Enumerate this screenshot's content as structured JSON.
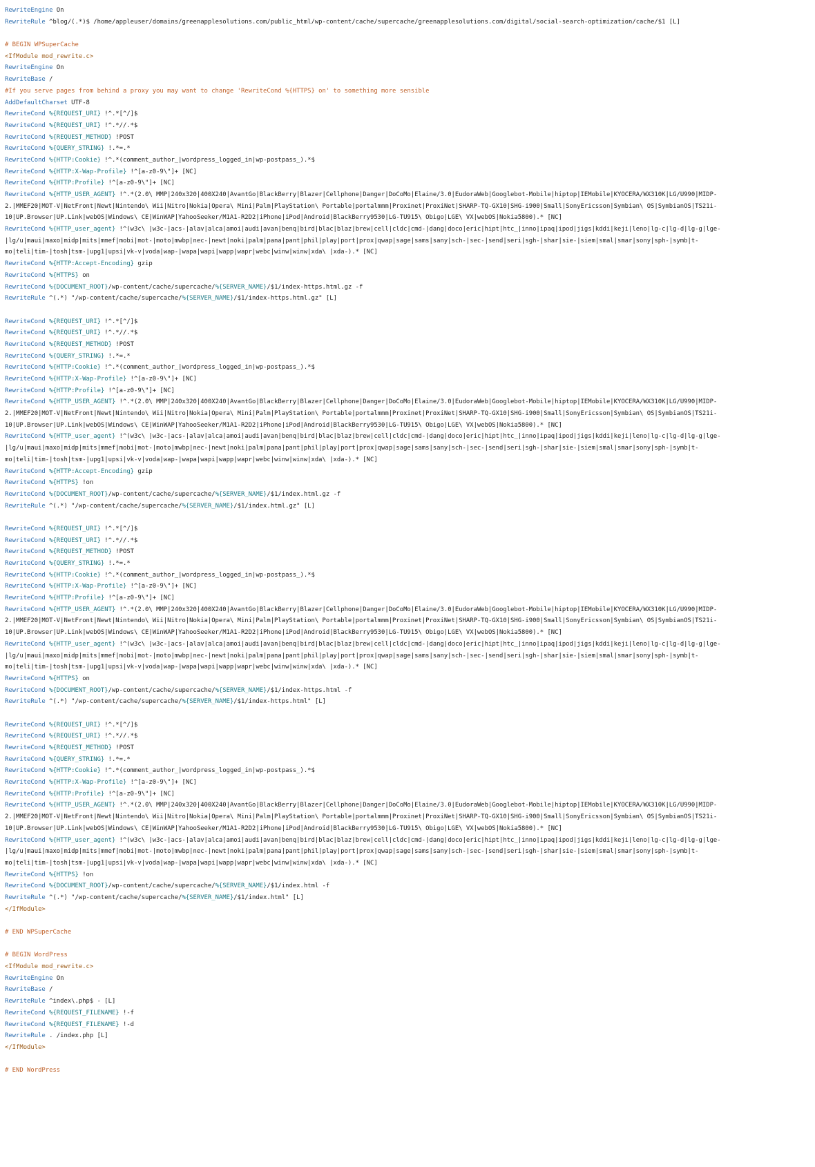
{
  "colors": {
    "directive": "#2f6fb0",
    "comment": "#c0622b",
    "tag": "#9b5a17",
    "variable": "#207b87",
    "text": "#222222",
    "background": "#ffffff"
  },
  "lines": [
    "RewriteEngine On",
    "RewriteRule ^blog/(.*)$ /home/appleuser/domains/greenapplesolutions.com/public_html/wp-content/cache/supercache/greenapplesolutions.com/digital/social-search-optimization/cache/$1 [L]",
    "",
    "# BEGIN WPSuperCache",
    "<IfModule mod_rewrite.c>",
    "RewriteEngine On",
    "RewriteBase /",
    "#If you serve pages from behind a proxy you may want to change 'RewriteCond %{HTTPS} on' to something more sensible",
    "AddDefaultCharset UTF-8",
    "RewriteCond %{REQUEST_URI} !^.*[^/]$",
    "RewriteCond %{REQUEST_URI} !^.*//.*$",
    "RewriteCond %{REQUEST_METHOD} !POST",
    "RewriteCond %{QUERY_STRING} !.*=.*",
    "RewriteCond %{HTTP:Cookie} !^.*(comment_author_|wordpress_logged_in|wp-postpass_).*$",
    "RewriteCond %{HTTP:X-Wap-Profile} !^[a-z0-9\\\"]+ [NC]",
    "RewriteCond %{HTTP:Profile} !^[a-z0-9\\\"]+ [NC]",
    "RewriteCond %{HTTP_USER_AGENT} !^.*(2.0\\ MMP|240x320|400X240|AvantGo|BlackBerry|Blazer|Cellphone|Danger|DoCoMo|Elaine/3.0|EudoraWeb|Googlebot-Mobile|hiptop|IEMobile|KYOCERA/WX310K|LG/U990|MIDP-",
    "2.|MMEF20|MOT-V|NetFront|Newt|Nintendo\\ Wii|Nitro|Nokia|Opera\\ Mini|Palm|PlayStation\\ Portable|portalmmm|Proxinet|ProxiNet|SHARP-TQ-GX10|SHG-i900|Small|SonyEricsson|Symbian\\ OS|SymbianOS|TS21i-",
    "10|UP.Browser|UP.Link|webOS|Windows\\ CE|WinWAP|YahooSeeker/M1A1-R2D2|iPhone|iPod|Android|BlackBerry9530|LG-TU915\\ Obigo|LGE\\ VX|webOS|Nokia5800).* [NC]",
    "RewriteCond %{HTTP_user_agent} !^(w3c\\ |w3c-|acs-|alav|alca|amoi|audi|avan|benq|bird|blac|blaz|brew|cell|cldc|cmd-|dang|doco|eric|hipt|htc_|inno|ipaq|ipod|jigs|kddi|keji|leno|lg-c|lg-d|lg-g|lge-",
    "|lg/u|maui|maxo|midp|mits|mmef|mobi|mot-|moto|mwbp|nec-|newt|noki|palm|pana|pant|phil|play|port|prox|qwap|sage|sams|sany|sch-|sec-|send|seri|sgh-|shar|sie-|siem|smal|smar|sony|sph-|symb|t-",
    "mo|teli|tim-|tosh|tsm-|upg1|upsi|vk-v|voda|wap-|wapa|wapi|wapp|wapr|webc|winw|winw|xda\\ |xda-).* [NC]",
    "RewriteCond %{HTTP:Accept-Encoding} gzip",
    "RewriteCond %{HTTPS} on",
    "RewriteCond %{DOCUMENT_ROOT}/wp-content/cache/supercache/%{SERVER_NAME}/$1/index-https.html.gz -f",
    "RewriteRule ^(.*) \"/wp-content/cache/supercache/%{SERVER_NAME}/$1/index-https.html.gz\" [L]",
    "",
    "RewriteCond %{REQUEST_URI} !^.*[^/]$",
    "RewriteCond %{REQUEST_URI} !^.*//.*$",
    "RewriteCond %{REQUEST_METHOD} !POST",
    "RewriteCond %{QUERY_STRING} !.*=.*",
    "RewriteCond %{HTTP:Cookie} !^.*(comment_author_|wordpress_logged_in|wp-postpass_).*$",
    "RewriteCond %{HTTP:X-Wap-Profile} !^[a-z0-9\\\"]+ [NC]",
    "RewriteCond %{HTTP:Profile} !^[a-z0-9\\\"]+ [NC]",
    "RewriteCond %{HTTP_USER_AGENT} !^.*(2.0\\ MMP|240x320|400X240|AvantGo|BlackBerry|Blazer|Cellphone|Danger|DoCoMo|Elaine/3.0|EudoraWeb|Googlebot-Mobile|hiptop|IEMobile|KYOCERA/WX310K|LG/U990|MIDP-",
    "2.|MMEF20|MOT-V|NetFront|Newt|Nintendo\\ Wii|Nitro|Nokia|Opera\\ Mini|Palm|PlayStation\\ Portable|portalmmm|Proxinet|ProxiNet|SHARP-TQ-GX10|SHG-i900|Small|SonyEricsson|Symbian\\ OS|SymbianOS|TS21i-",
    "10|UP.Browser|UP.Link|webOS|Windows\\ CE|WinWAP|YahooSeeker/M1A1-R2D2|iPhone|iPod|Android|BlackBerry9530|LG-TU915\\ Obigo|LGE\\ VX|webOS|Nokia5800).* [NC]",
    "RewriteCond %{HTTP_user_agent} !^(w3c\\ |w3c-|acs-|alav|alca|amoi|audi|avan|benq|bird|blac|blaz|brew|cell|cldc|cmd-|dang|doco|eric|hipt|htc_|inno|ipaq|ipod|jigs|kddi|keji|leno|lg-c|lg-d|lg-g|lge-",
    "|lg/u|maui|maxo|midp|mits|mmef|mobi|mot-|moto|mwbp|nec-|newt|noki|palm|pana|pant|phil|play|port|prox|qwap|sage|sams|sany|sch-|sec-|send|seri|sgh-|shar|sie-|siem|smal|smar|sony|sph-|symb|t-",
    "mo|teli|tim-|tosh|tsm-|upg1|upsi|vk-v|voda|wap-|wapa|wapi|wapp|wapr|webc|winw|winw|xda\\ |xda-).* [NC]",
    "RewriteCond %{HTTP:Accept-Encoding} gzip",
    "RewriteCond %{HTTPS} !on",
    "RewriteCond %{DOCUMENT_ROOT}/wp-content/cache/supercache/%{SERVER_NAME}/$1/index.html.gz -f",
    "RewriteRule ^(.*) \"/wp-content/cache/supercache/%{SERVER_NAME}/$1/index.html.gz\" [L]",
    "",
    "RewriteCond %{REQUEST_URI} !^.*[^/]$",
    "RewriteCond %{REQUEST_URI} !^.*//.*$",
    "RewriteCond %{REQUEST_METHOD} !POST",
    "RewriteCond %{QUERY_STRING} !.*=.*",
    "RewriteCond %{HTTP:Cookie} !^.*(comment_author_|wordpress_logged_in|wp-postpass_).*$",
    "RewriteCond %{HTTP:X-Wap-Profile} !^[a-z0-9\\\"]+ [NC]",
    "RewriteCond %{HTTP:Profile} !^[a-z0-9\\\"]+ [NC]",
    "RewriteCond %{HTTP_USER_AGENT} !^.*(2.0\\ MMP|240x320|400X240|AvantGo|BlackBerry|Blazer|Cellphone|Danger|DoCoMo|Elaine/3.0|EudoraWeb|Googlebot-Mobile|hiptop|IEMobile|KYOCERA/WX310K|LG/U990|MIDP-",
    "2.|MMEF20|MOT-V|NetFront|Newt|Nintendo\\ Wii|Nitro|Nokia|Opera\\ Mini|Palm|PlayStation\\ Portable|portalmmm|Proxinet|ProxiNet|SHARP-TQ-GX10|SHG-i900|Small|SonyEricsson|Symbian\\ OS|SymbianOS|TS21i-",
    "10|UP.Browser|UP.Link|webOS|Windows\\ CE|WinWAP|YahooSeeker/M1A1-R2D2|iPhone|iPod|Android|BlackBerry9530|LG-TU915\\ Obigo|LGE\\ VX|webOS|Nokia5800).* [NC]",
    "RewriteCond %{HTTP_user_agent} !^(w3c\\ |w3c-|acs-|alav|alca|amoi|audi|avan|benq|bird|blac|blaz|brew|cell|cldc|cmd-|dang|doco|eric|hipt|htc_|inno|ipaq|ipod|jigs|kddi|keji|leno|lg-c|lg-d|lg-g|lge-",
    "|lg/u|maui|maxo|midp|mits|mmef|mobi|mot-|moto|mwbp|nec-|newt|noki|palm|pana|pant|phil|play|port|prox|qwap|sage|sams|sany|sch-|sec-|send|seri|sgh-|shar|sie-|siem|smal|smar|sony|sph-|symb|t-",
    "mo|teli|tim-|tosh|tsm-|upg1|upsi|vk-v|voda|wap-|wapa|wapi|wapp|wapr|webc|winw|winw|xda\\ |xda-).* [NC]",
    "RewriteCond %{HTTPS} on",
    "RewriteCond %{DOCUMENT_ROOT}/wp-content/cache/supercache/%{SERVER_NAME}/$1/index-https.html -f",
    "RewriteRule ^(.*) \"/wp-content/cache/supercache/%{SERVER_NAME}/$1/index-https.html\" [L]",
    "",
    "RewriteCond %{REQUEST_URI} !^.*[^/]$",
    "RewriteCond %{REQUEST_URI} !^.*//.*$",
    "RewriteCond %{REQUEST_METHOD} !POST",
    "RewriteCond %{QUERY_STRING} !.*=.*",
    "RewriteCond %{HTTP:Cookie} !^.*(comment_author_|wordpress_logged_in|wp-postpass_).*$",
    "RewriteCond %{HTTP:X-Wap-Profile} !^[a-z0-9\\\"]+ [NC]",
    "RewriteCond %{HTTP:Profile} !^[a-z0-9\\\"]+ [NC]",
    "RewriteCond %{HTTP_USER_AGENT} !^.*(2.0\\ MMP|240x320|400X240|AvantGo|BlackBerry|Blazer|Cellphone|Danger|DoCoMo|Elaine/3.0|EudoraWeb|Googlebot-Mobile|hiptop|IEMobile|KYOCERA/WX310K|LG/U990|MIDP-",
    "2.|MMEF20|MOT-V|NetFront|Newt|Nintendo\\ Wii|Nitro|Nokia|Opera\\ Mini|Palm|PlayStation\\ Portable|portalmmm|Proxinet|ProxiNet|SHARP-TQ-GX10|SHG-i900|Small|SonyEricsson|Symbian\\ OS|SymbianOS|TS21i-",
    "10|UP.Browser|UP.Link|webOS|Windows\\ CE|WinWAP|YahooSeeker/M1A1-R2D2|iPhone|iPod|Android|BlackBerry9530|LG-TU915\\ Obigo|LGE\\ VX|webOS|Nokia5800).* [NC]",
    "RewriteCond %{HTTP_user_agent} !^(w3c\\ |w3c-|acs-|alav|alca|amoi|audi|avan|benq|bird|blac|blaz|brew|cell|cldc|cmd-|dang|doco|eric|hipt|htc_|inno|ipaq|ipod|jigs|kddi|keji|leno|lg-c|lg-d|lg-g|lge-",
    "|lg/u|maui|maxo|midp|mits|mmef|mobi|mot-|moto|mwbp|nec-|newt|noki|palm|pana|pant|phil|play|port|prox|qwap|sage|sams|sany|sch-|sec-|send|seri|sgh-|shar|sie-|siem|smal|smar|sony|sph-|symb|t-",
    "mo|teli|tim-|tosh|tsm-|upg1|upsi|vk-v|voda|wap-|wapa|wapi|wapp|wapr|webc|winw|winw|xda\\ |xda-).* [NC]",
    "RewriteCond %{HTTPS} !on",
    "RewriteCond %{DOCUMENT_ROOT}/wp-content/cache/supercache/%{SERVER_NAME}/$1/index.html -f",
    "RewriteRule ^(.*) \"/wp-content/cache/supercache/%{SERVER_NAME}/$1/index.html\" [L]",
    "</IfModule>",
    "",
    "# END WPSuperCache",
    "",
    "# BEGIN WordPress",
    "<IfModule mod_rewrite.c>",
    "RewriteEngine On",
    "RewriteBase /",
    "RewriteRule ^index\\.php$ - [L]",
    "RewriteCond %{REQUEST_FILENAME} !-f",
    "RewriteCond %{REQUEST_FILENAME} !-d",
    "RewriteRule . /index.php [L]",
    "</IfModule>",
    "",
    "# END WordPress"
  ]
}
